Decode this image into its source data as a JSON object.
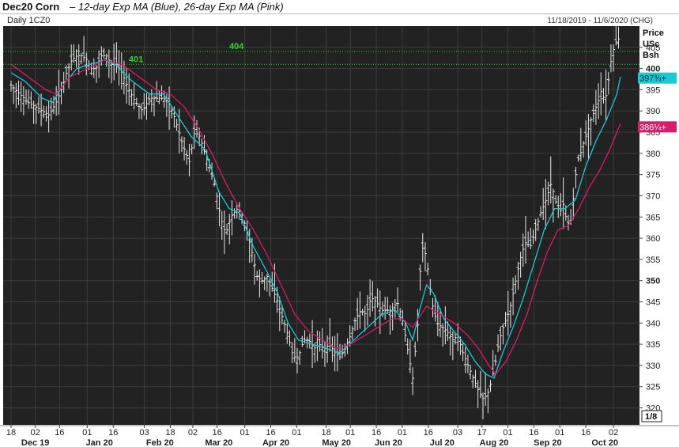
{
  "header": {
    "title_bold": "Dec20 Corn",
    "title_italic": "– 12-day Exp MA (Blue), 26-day Exp MA (Pink)"
  },
  "panel": {
    "label": "Daily 1CZ0",
    "range": "11/18/2019 - 11/6/2020 (CHG)",
    "price_label": [
      "Price",
      "USc",
      "Bsh"
    ],
    "tick_fraction": "1/8"
  },
  "colors": {
    "background": "#222222",
    "bars": "#e8e8e8",
    "ma12": "#1ec8d2",
    "ma26": "#d81b6a",
    "reference": "#2fd42f",
    "grid": "#3c3c3c"
  },
  "chart_data": {
    "type": "line",
    "title": "Dec20 Corn",
    "subtitle": "12-day Exp MA (Blue), 26-day Exp MA (Pink)",
    "ylabel": "Price USc Bsh",
    "ylim": [
      316,
      410
    ],
    "y_ticks": [
      320,
      325,
      330,
      335,
      340,
      345,
      350,
      355,
      360,
      365,
      370,
      375,
      380,
      385,
      390,
      395,
      400,
      405
    ],
    "x_tick_labels": [
      "18",
      "02",
      "16",
      "01",
      "16",
      "03",
      "18",
      "02",
      "16",
      "01",
      "16",
      "01",
      "18",
      "01",
      "16",
      "01",
      "16",
      "03",
      "17",
      "01",
      "16",
      "01",
      "16",
      "02"
    ],
    "x_tick_days": [
      0,
      14,
      28,
      44,
      59,
      77,
      92,
      105,
      119,
      135,
      150,
      165,
      182,
      196,
      211,
      226,
      241,
      258,
      272,
      287,
      302,
      317,
      332,
      348
    ],
    "month_labels": [
      "Dec 19",
      "Jan 20",
      "Feb 20",
      "Mar 20",
      "Apr 20",
      "May 20",
      "Jun 20",
      "Jul 20",
      "Aug 20",
      "Sep 20",
      "Oct 20"
    ],
    "month_label_days": [
      14,
      51,
      86,
      120,
      153,
      188,
      218,
      249,
      279,
      310,
      343
    ],
    "reference_lines": [
      {
        "value": 404,
        "label": "404"
      },
      {
        "value": 401,
        "label": "401"
      }
    ],
    "last_values": [
      {
        "label": "397¾+",
        "value": 397.75
      },
      {
        "label": "386¼+",
        "value": 386.25
      }
    ],
    "ohlc_close_path": [
      [
        0,
        396
      ],
      [
        5,
        394
      ],
      [
        10,
        392
      ],
      [
        14,
        391
      ],
      [
        18,
        390
      ],
      [
        22,
        389
      ],
      [
        26,
        392
      ],
      [
        29,
        395
      ],
      [
        32,
        399
      ],
      [
        35,
        402
      ],
      [
        38,
        403
      ],
      [
        41,
        403
      ],
      [
        44,
        402
      ],
      [
        46,
        400
      ],
      [
        49,
        400
      ],
      [
        52,
        403
      ],
      [
        55,
        403
      ],
      [
        58,
        401
      ],
      [
        61,
        401
      ],
      [
        64,
        399
      ],
      [
        68,
        395
      ],
      [
        72,
        392
      ],
      [
        76,
        390
      ],
      [
        80,
        393
      ],
      [
        84,
        393
      ],
      [
        88,
        393
      ],
      [
        91,
        392
      ],
      [
        94,
        389
      ],
      [
        97,
        385
      ],
      [
        100,
        381
      ],
      [
        103,
        378
      ],
      [
        106,
        385
      ],
      [
        109,
        384
      ],
      [
        112,
        380
      ],
      [
        115,
        376
      ],
      [
        118,
        372
      ],
      [
        121,
        365
      ],
      [
        124,
        361
      ],
      [
        127,
        365
      ],
      [
        130,
        367
      ],
      [
        133,
        366
      ],
      [
        136,
        362
      ],
      [
        139,
        357
      ],
      [
        142,
        351
      ],
      [
        145,
        350
      ],
      [
        148,
        351
      ],
      [
        151,
        348
      ],
      [
        154,
        345
      ],
      [
        157,
        341
      ],
      [
        160,
        337
      ],
      [
        163,
        332
      ],
      [
        166,
        332
      ],
      [
        169,
        336
      ],
      [
        172,
        336
      ],
      [
        175,
        334
      ],
      [
        178,
        335
      ],
      [
        181,
        334
      ],
      [
        184,
        335
      ],
      [
        187,
        333
      ],
      [
        190,
        332
      ],
      [
        193,
        334
      ],
      [
        196,
        337
      ],
      [
        199,
        341
      ],
      [
        202,
        343
      ],
      [
        205,
        342
      ],
      [
        208,
        346
      ],
      [
        211,
        345
      ],
      [
        214,
        343
      ],
      [
        217,
        343
      ],
      [
        220,
        343
      ],
      [
        223,
        345
      ],
      [
        226,
        341
      ],
      [
        229,
        334
      ],
      [
        232,
        327
      ],
      [
        235,
        340
      ],
      [
        237,
        358
      ],
      [
        239,
        357
      ],
      [
        241,
        352
      ],
      [
        243,
        345
      ],
      [
        246,
        340
      ],
      [
        249,
        339
      ],
      [
        252,
        338
      ],
      [
        255,
        336
      ],
      [
        258,
        337
      ],
      [
        261,
        333
      ],
      [
        264,
        330
      ],
      [
        267,
        327
      ],
      [
        270,
        324
      ],
      [
        273,
        322
      ],
      [
        276,
        324
      ],
      [
        279,
        329
      ],
      [
        282,
        336
      ],
      [
        285,
        340
      ],
      [
        288,
        343
      ],
      [
        291,
        349
      ],
      [
        294,
        355
      ],
      [
        297,
        359
      ],
      [
        300,
        358
      ],
      [
        303,
        362
      ],
      [
        306,
        366
      ],
      [
        309,
        369
      ],
      [
        312,
        373
      ],
      [
        315,
        368
      ],
      [
        317,
        366
      ],
      [
        319,
        368
      ],
      [
        321,
        364
      ],
      [
        323,
        363
      ],
      [
        325,
        370
      ],
      [
        327,
        378
      ],
      [
        329,
        380
      ],
      [
        331,
        383
      ],
      [
        333,
        385
      ],
      [
        335,
        388
      ],
      [
        337,
        390
      ],
      [
        339,
        392
      ],
      [
        341,
        395
      ],
      [
        343,
        392
      ],
      [
        345,
        397
      ],
      [
        347,
        403
      ],
      [
        349,
        406
      ],
      [
        351,
        407
      ]
    ],
    "series": [
      {
        "name": "12-day Exp MA (Blue)",
        "color": "#1ec8d2",
        "points": [
          [
            0,
            399
          ],
          [
            8,
            397
          ],
          [
            18,
            393
          ],
          [
            24,
            392
          ],
          [
            30,
            396
          ],
          [
            38,
            400
          ],
          [
            46,
            401
          ],
          [
            54,
            402
          ],
          [
            60,
            401
          ],
          [
            70,
            397
          ],
          [
            80,
            394
          ],
          [
            88,
            394
          ],
          [
            96,
            389
          ],
          [
            104,
            384
          ],
          [
            112,
            381
          ],
          [
            120,
            371
          ],
          [
            126,
            367
          ],
          [
            132,
            366
          ],
          [
            140,
            358
          ],
          [
            148,
            352
          ],
          [
            154,
            347
          ],
          [
            160,
            340
          ],
          [
            166,
            336
          ],
          [
            174,
            335
          ],
          [
            182,
            334
          ],
          [
            190,
            333
          ],
          [
            198,
            336
          ],
          [
            206,
            339
          ],
          [
            214,
            342
          ],
          [
            222,
            343
          ],
          [
            228,
            340
          ],
          [
            232,
            336
          ],
          [
            236,
            343
          ],
          [
            240,
            349
          ],
          [
            244,
            347
          ],
          [
            250,
            341
          ],
          [
            256,
            338
          ],
          [
            262,
            335
          ],
          [
            268,
            331
          ],
          [
            274,
            328
          ],
          [
            279,
            327
          ],
          [
            284,
            333
          ],
          [
            290,
            339
          ],
          [
            296,
            346
          ],
          [
            302,
            354
          ],
          [
            308,
            362
          ],
          [
            314,
            367
          ],
          [
            320,
            367
          ],
          [
            326,
            369
          ],
          [
            332,
            377
          ],
          [
            338,
            383
          ],
          [
            344,
            388
          ],
          [
            350,
            394
          ],
          [
            352,
            398
          ]
        ]
      },
      {
        "name": "26-day Exp MA (Pink)",
        "color": "#d81b6a",
        "points": [
          [
            0,
            401
          ],
          [
            10,
            398
          ],
          [
            20,
            395
          ],
          [
            26,
            394
          ],
          [
            34,
            398
          ],
          [
            44,
            400
          ],
          [
            54,
            402
          ],
          [
            64,
            401
          ],
          [
            74,
            398
          ],
          [
            84,
            395
          ],
          [
            92,
            394
          ],
          [
            100,
            391
          ],
          [
            108,
            386
          ],
          [
            116,
            380
          ],
          [
            124,
            373
          ],
          [
            132,
            367
          ],
          [
            140,
            362
          ],
          [
            148,
            356
          ],
          [
            156,
            349
          ],
          [
            164,
            342
          ],
          [
            172,
            338
          ],
          [
            180,
            336
          ],
          [
            188,
            334
          ],
          [
            196,
            335
          ],
          [
            204,
            337
          ],
          [
            212,
            339
          ],
          [
            220,
            341
          ],
          [
            226,
            341
          ],
          [
            232,
            339
          ],
          [
            240,
            344
          ],
          [
            248,
            342
          ],
          [
            256,
            340
          ],
          [
            264,
            337
          ],
          [
            270,
            334
          ],
          [
            276,
            330
          ],
          [
            280,
            328
          ],
          [
            286,
            331
          ],
          [
            292,
            336
          ],
          [
            298,
            342
          ],
          [
            304,
            350
          ],
          [
            310,
            357
          ],
          [
            316,
            362
          ],
          [
            322,
            363
          ],
          [
            328,
            367
          ],
          [
            334,
            372
          ],
          [
            340,
            376
          ],
          [
            346,
            381
          ],
          [
            352,
            387
          ]
        ]
      }
    ]
  }
}
